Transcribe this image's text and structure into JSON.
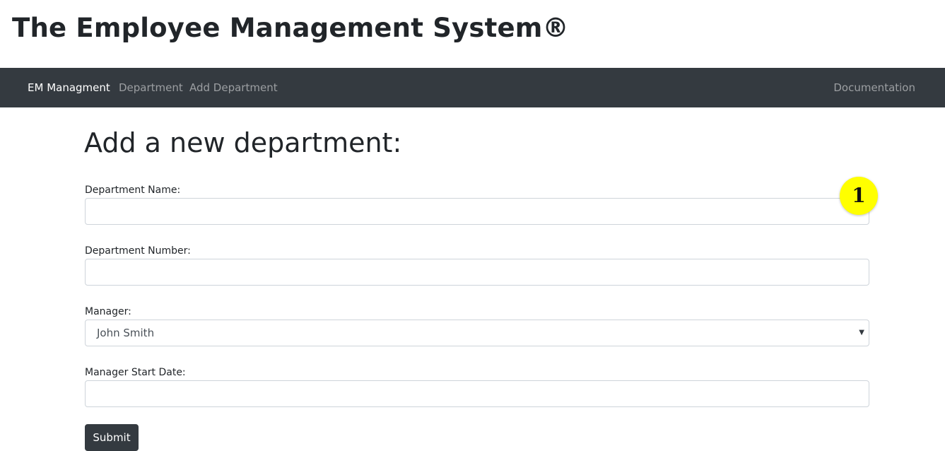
{
  "header": {
    "title": "The Employee Management System®"
  },
  "navbar": {
    "brand": "EM Managment",
    "items": [
      {
        "label": "Department"
      },
      {
        "label": "Add Department"
      }
    ],
    "right_item": "Documentation"
  },
  "form": {
    "heading": "Add a new department:",
    "department_name": {
      "label": "Department Name:",
      "value": ""
    },
    "department_number": {
      "label": "Department Number:",
      "value": ""
    },
    "manager": {
      "label": "Manager:",
      "selected": "John Smith"
    },
    "manager_start_date": {
      "label": "Manager Start Date:",
      "value": ""
    },
    "submit_label": "Submit"
  },
  "annotation": {
    "marker_label": "1"
  },
  "colors": {
    "navbar_bg": "#343a40",
    "marker_bg": "#ffff00",
    "button_bg": "#343a40"
  }
}
